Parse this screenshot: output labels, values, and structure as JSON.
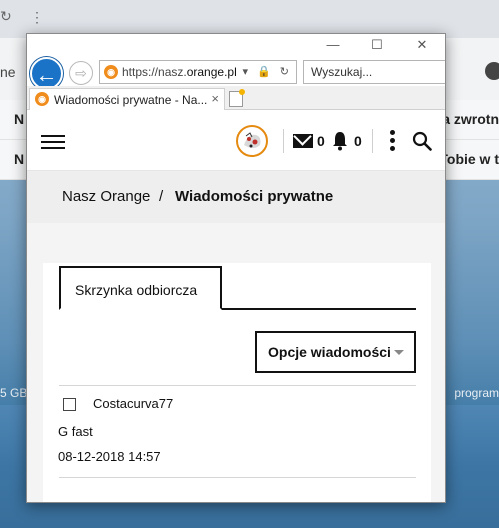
{
  "background": {
    "left_fragment": "ne",
    "row1_letter": "N",
    "row1_fragment": "a zwrotn",
    "row2_letter": "N",
    "row2_fragment": "Tobie w t",
    "storage_fragment": "5 GB",
    "program_fragment": "program"
  },
  "browser": {
    "url_prefix": "https://nasz.",
    "url_domain": "orange.pl",
    "search_placeholder": "Wyszukaj...",
    "tab_title": "Wiadomości prywatne - Na...",
    "tab_close": "×",
    "back_glyph": "←",
    "forward_glyph": "⇨",
    "minimize_glyph": "—",
    "maximize_glyph": "☐",
    "close_glyph": "✕",
    "url_icons": "▾ 🔒 ↻"
  },
  "header": {
    "mail_count": "0",
    "notification_count": "0",
    "icons": [
      "menu-icon",
      "avatar",
      "mail-icon",
      "bell-icon",
      "kebab-icon",
      "search-icon"
    ]
  },
  "breadcrumb": {
    "root": "Nasz Orange",
    "separator": "/",
    "current": "Wiadomości prywatne"
  },
  "messages": {
    "tab_inbox": "Skrzynka odbiorcza",
    "options_button": "Opcje wiadomości",
    "items": [
      {
        "sender": "Costacurva77",
        "subject": "G fast",
        "date": "08-12-2018 14:57"
      }
    ]
  },
  "colors": {
    "accent_orange": "#f08c1b",
    "ie_blue": "#1a73c7",
    "text": "#111111"
  }
}
